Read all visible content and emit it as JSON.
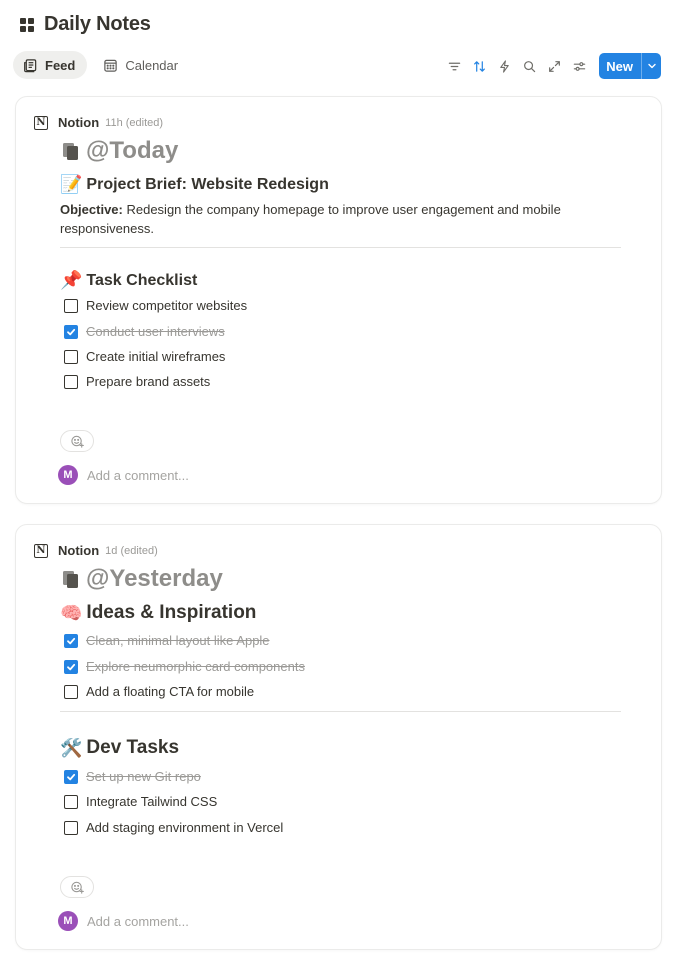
{
  "page": {
    "title": "Daily Notes",
    "title_icon": "grid-icon"
  },
  "tabs": [
    {
      "label": "Feed",
      "icon": "feed-icon",
      "active": true
    },
    {
      "label": "Calendar",
      "icon": "calendar-icon",
      "active": false
    }
  ],
  "toolbar": {
    "icons": [
      "filter-icon",
      "sort-icon",
      "lightning-icon",
      "search-icon",
      "expand-icon",
      "settings-icon"
    ],
    "new_label": "New",
    "accent": "#2383e2"
  },
  "posts": [
    {
      "author": "Notion",
      "time": "11h (edited)",
      "date_title": "@Today",
      "sections": [
        {
          "emoji": "📝",
          "heading": "Project Brief: Website Redesign",
          "para_bold": "Objective:",
          "para_text": " Redesign the company homepage to improve user engagement and mobile responsiveness."
        },
        {
          "emoji": "📌",
          "heading": "Task Checklist",
          "todos": [
            {
              "label": "Review competitor websites",
              "checked": false
            },
            {
              "label": "Conduct user interviews",
              "checked": true
            },
            {
              "label": "Create initial wireframes",
              "checked": false
            },
            {
              "label": "Prepare brand assets",
              "checked": false
            }
          ]
        }
      ],
      "comment_avatar": "M",
      "comment_placeholder": "Add a comment..."
    },
    {
      "author": "Notion",
      "time": "1d (edited)",
      "date_title": "@Yesterday",
      "sections": [
        {
          "emoji": "🧠",
          "heading": "Ideas & Inspiration",
          "todos": [
            {
              "label": "Clean, minimal layout like Apple",
              "checked": true
            },
            {
              "label": "Explore neumorphic card components",
              "checked": true
            },
            {
              "label": "Add a floating CTA for mobile",
              "checked": false
            }
          ]
        },
        {
          "emoji": "🛠️",
          "heading": "Dev Tasks",
          "todos": [
            {
              "label": "Set up new Git repo",
              "checked": true
            },
            {
              "label": "Integrate Tailwind CSS",
              "checked": false
            },
            {
              "label": "Add staging environment in Vercel",
              "checked": false
            }
          ]
        }
      ],
      "comment_avatar": "M",
      "comment_placeholder": "Add a comment..."
    }
  ]
}
